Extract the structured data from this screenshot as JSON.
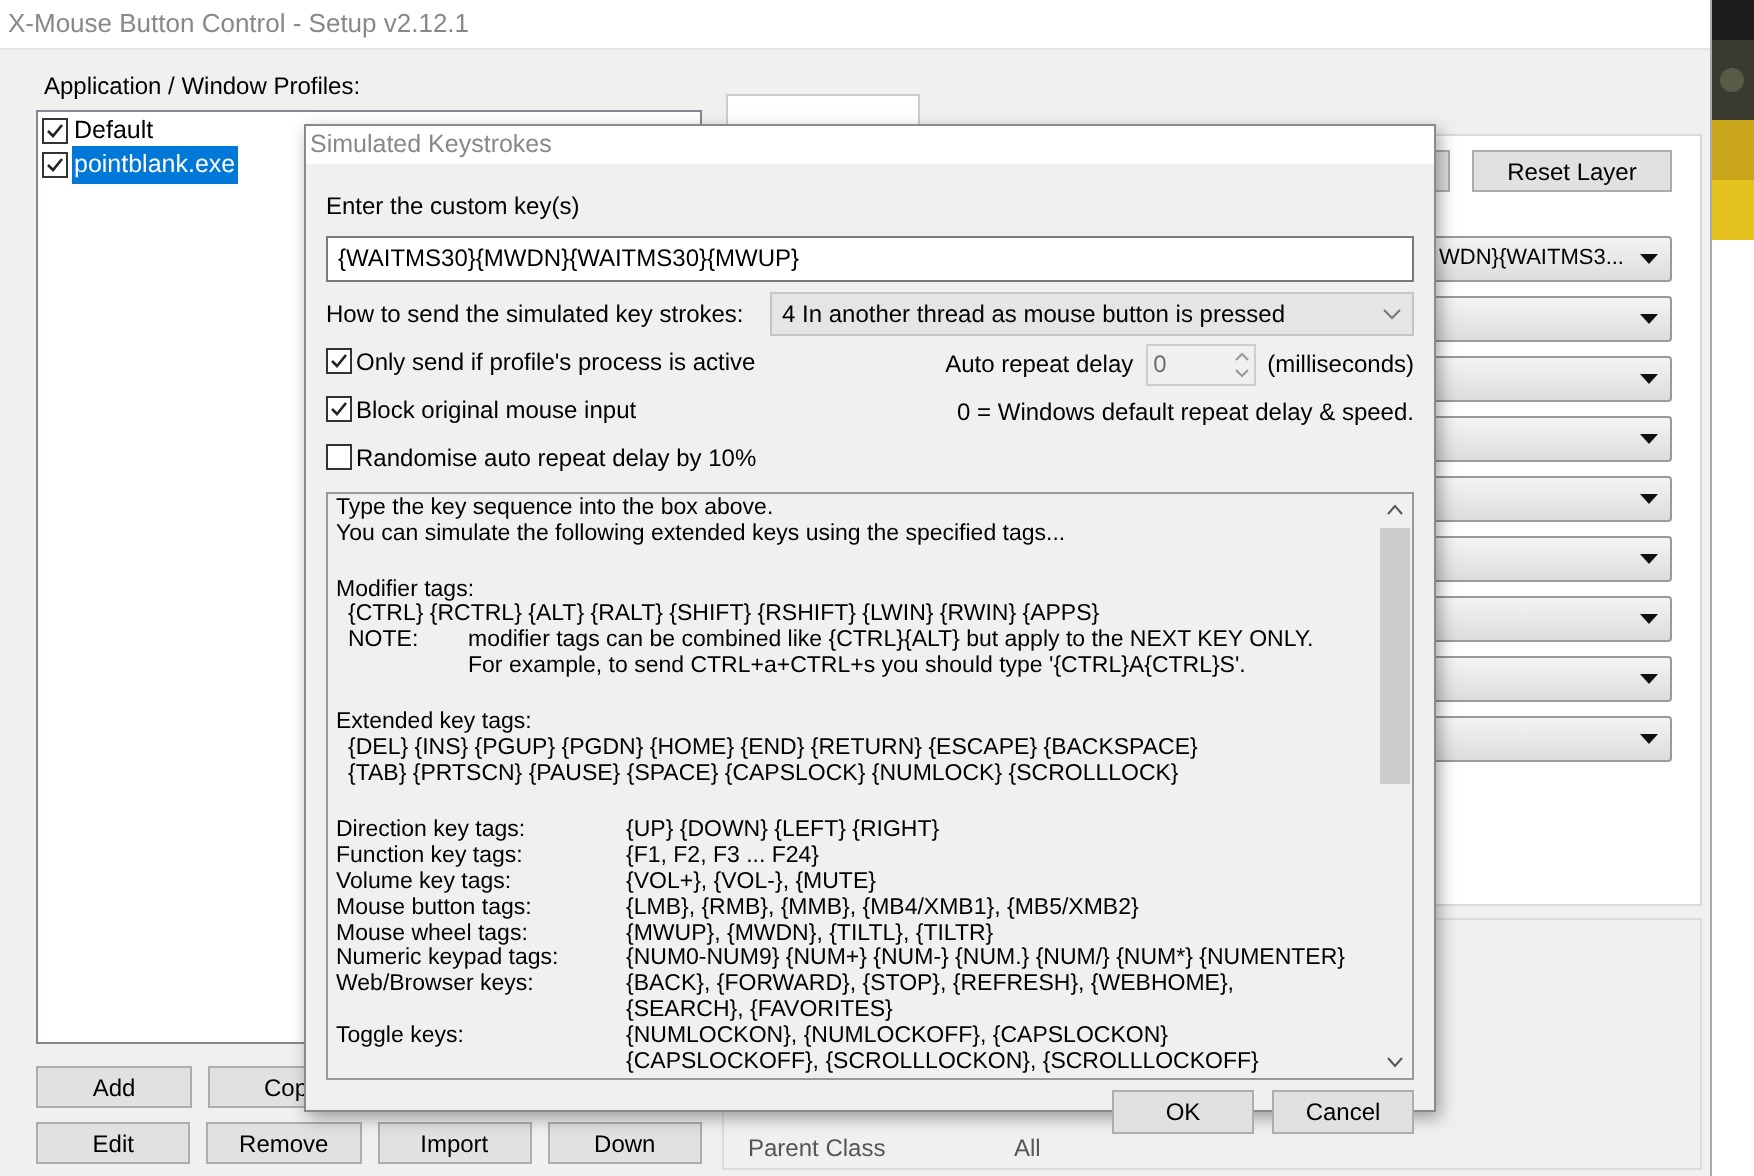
{
  "window": {
    "title": "X-Mouse Button Control - Setup v2.12.1"
  },
  "profiles": {
    "label": "Application / Window Profiles:",
    "items": [
      {
        "label": "Default",
        "checked": true,
        "selected": false
      },
      {
        "label": "pointblank.exe",
        "checked": true,
        "selected": true
      }
    ]
  },
  "profile_buttons": [
    [
      "Add",
      "Cop"
    ],
    [
      "Edit",
      "Remove",
      "Import",
      "Down"
    ]
  ],
  "layer": {
    "reset_button": "Reset Layer",
    "dropdowns": [
      {
        "kind": "text",
        "value": "WDN}{WAITMS3..."
      },
      {
        "kind": "empty"
      },
      {
        "kind": "empty"
      },
      {
        "kind": "empty"
      },
      {
        "kind": "empty"
      },
      {
        "kind": "empty"
      },
      {
        "kind": "empty"
      },
      {
        "kind": "empty"
      },
      {
        "kind": "empty"
      }
    ]
  },
  "window_info": {
    "label": "Parent Class",
    "value": "All"
  },
  "dialog": {
    "title": "Simulated Keystrokes",
    "key_label": "Enter the custom key(s)",
    "key_value": "{WAITMS30}{MWDN}{WAITMS30}{MWUP}",
    "send_label": "How to send the simulated key strokes:",
    "send_value": "4 In another thread as mouse button is pressed",
    "options": [
      {
        "label": "Only send if profile's process is active",
        "checked": true
      },
      {
        "label": "Block original mouse input",
        "checked": true
      },
      {
        "label": "Randomise auto repeat delay by 10%",
        "checked": false
      }
    ],
    "repeat": {
      "label": "Auto repeat delay",
      "value": "0",
      "unit": "(milliseconds)",
      "note": "0 = Windows default repeat delay & speed."
    },
    "help": [
      {
        "kind": "text",
        "text": "Type the key sequence into the box above."
      },
      {
        "kind": "text",
        "text": "You can simulate the following extended keys using the specified tags..."
      },
      {
        "kind": "blank"
      },
      {
        "kind": "text",
        "text": "Modifier tags:"
      },
      {
        "kind": "indent",
        "text": "{CTRL} {RCTRL} {ALT} {RALT} {SHIFT} {RSHIFT} {LWIN} {RWIN} {APPS}"
      },
      {
        "kind": "note",
        "label": "NOTE:",
        "text": "modifier tags can be combined like {CTRL}{ALT} but apply to the NEXT KEY ONLY."
      },
      {
        "kind": "note_cont",
        "text": "For example, to send CTRL+a+CTRL+s you should type '{CTRL}A{CTRL}S'."
      },
      {
        "kind": "blank"
      },
      {
        "kind": "text",
        "text": "Extended key tags:"
      },
      {
        "kind": "indent",
        "text": "{DEL} {INS} {PGUP} {PGDN} {HOME} {END} {RETURN} {ESCAPE} {BACKSPACE}"
      },
      {
        "kind": "indent",
        "text": "{TAB} {PRTSCN} {PAUSE} {SPACE} {CAPSLOCK} {NUMLOCK} {SCROLLLOCK}"
      },
      {
        "kind": "blank"
      },
      {
        "kind": "pair",
        "label": "Direction key tags:",
        "value": "{UP} {DOWN} {LEFT} {RIGHT}"
      },
      {
        "kind": "pair",
        "label": "Function key tags:",
        "value": "{F1, F2, F3 ... F24}"
      },
      {
        "kind": "pair",
        "label": "Volume key tags:",
        "value": "{VOL+}, {VOL-}, {MUTE}"
      },
      {
        "kind": "pair",
        "label": "Mouse button tags:",
        "value": "{LMB}, {RMB}, {MMB}, {MB4/XMB1}, {MB5/XMB2}"
      },
      {
        "kind": "pair",
        "label": "Mouse wheel tags:",
        "value": "{MWUP}, {MWDN}, {TILTL}, {TILTR}"
      },
      {
        "kind": "pair",
        "label": "Numeric keypad tags:",
        "value": "{NUM0-NUM9} {NUM+} {NUM-} {NUM.} {NUM/} {NUM*} {NUMENTER}"
      },
      {
        "kind": "pair",
        "label": "Web/Browser keys:",
        "value": "{BACK}, {FORWARD}, {STOP}, {REFRESH}, {WEBHOME},"
      },
      {
        "kind": "pair_cont",
        "value": "{SEARCH}, {FAVORITES}"
      },
      {
        "kind": "pair",
        "label": "Toggle keys:",
        "value": "{NUMLOCKON}, {NUMLOCKOFF}, {CAPSLOCKON}"
      },
      {
        "kind": "pair_cont",
        "value": "{CAPSLOCKOFF}, {SCROLLLOCKON}, {SCROLLLOCKOFF}"
      }
    ],
    "buttons": [
      "OK",
      "Cancel"
    ]
  }
}
